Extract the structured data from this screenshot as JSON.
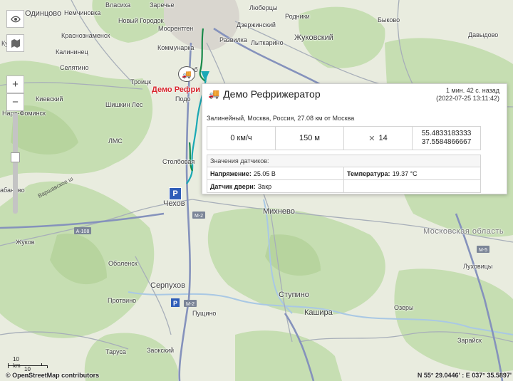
{
  "places": [
    {
      "id": "vlasikha",
      "name": "Власиха"
    },
    {
      "id": "zarechye",
      "name": "Заречье"
    },
    {
      "id": "lyubertsy",
      "name": "Люберцы"
    },
    {
      "id": "odintsovo",
      "name": "Одинцово"
    },
    {
      "id": "nemchinovka",
      "name": "Немчиновка"
    },
    {
      "id": "novy_gorodok",
      "name": "Новый Городок"
    },
    {
      "id": "mosrentgen",
      "name": "Мосрентген"
    },
    {
      "id": "dzerzhinsky",
      "name": "Дзержинский"
    },
    {
      "id": "rodniki",
      "name": "Родники"
    },
    {
      "id": "kubinka",
      "name": "Кубинка"
    },
    {
      "id": "krasnoznamensk",
      "name": "Краснознаменск"
    },
    {
      "id": "razvilka",
      "name": "Развилка"
    },
    {
      "id": "lytkarino",
      "name": "Лыткарино"
    },
    {
      "id": "zhukovsky",
      "name": "Жуковский"
    },
    {
      "id": "bykovo",
      "name": "Быково"
    },
    {
      "id": "davydovo",
      "name": "Давыдово"
    },
    {
      "id": "kalininets",
      "name": "Калининец"
    },
    {
      "id": "kommunarka",
      "name": "Коммунарка"
    },
    {
      "id": "selyatino",
      "name": "Селятино"
    },
    {
      "id": "troitsk",
      "name": "Троицк"
    },
    {
      "id": "shcherbinka",
      "name": "Щерб"
    },
    {
      "id": "kievsky",
      "name": "Киевский"
    },
    {
      "id": "podolsk",
      "name": "Подо"
    },
    {
      "id": "naro_fominsk",
      "name": "Наро-Фоминск"
    },
    {
      "id": "shishkin_les",
      "name": "Шишкин Лес"
    },
    {
      "id": "lms",
      "name": "ЛМС"
    },
    {
      "id": "stolbovaya",
      "name": "Столбовая"
    },
    {
      "id": "chekhov",
      "name": "Чехов"
    },
    {
      "id": "mikhnevo",
      "name": "Михнево"
    },
    {
      "id": "tabanovo",
      "name": "абаново"
    },
    {
      "id": "zhukov",
      "name": "Жуков"
    },
    {
      "id": "moscow_oblast",
      "name": "Московская область"
    },
    {
      "id": "obolensk",
      "name": "Оболенск"
    },
    {
      "id": "lukhovitsy",
      "name": "Луховицы"
    },
    {
      "id": "serpukhov",
      "name": "Серпухов"
    },
    {
      "id": "stupino",
      "name": "Ступино"
    },
    {
      "id": "protvino",
      "name": "Протвино"
    },
    {
      "id": "kashira",
      "name": "Кашира"
    },
    {
      "id": "ozery",
      "name": "Озеры"
    },
    {
      "id": "pushchino",
      "name": "Пущино"
    },
    {
      "id": "zaraysk",
      "name": "Зарайск"
    },
    {
      "id": "tarusa",
      "name": "Таруса"
    },
    {
      "id": "zaoksky",
      "name": "Заокский"
    },
    {
      "id": "ku",
      "name": "Ку"
    }
  ],
  "roads": {
    "a108": "А-108",
    "m2_a": "М-2",
    "m2_b": "М-2",
    "m5": "М-5",
    "varshavskoe": "Варшавское ш"
  },
  "map_tools": {
    "eye_icon": "eye-icon",
    "map_icon": "map-icon",
    "zoom_in": "+",
    "zoom_out": "−"
  },
  "zoom_level_fraction": 0.56,
  "vehicle": {
    "label": "Демо Рефри"
  },
  "parking": {
    "label": "P"
  },
  "popup": {
    "title": "Демо Рефрижератор",
    "time_ago": "1 мин. 42 с. назад",
    "timestamp": "(2022-07-25 13:11:42)",
    "address": "Залинейный, Москва, Россия, 27.08 км от Москва",
    "speed": "0 км/ч",
    "altitude": "150 м",
    "satellites": "14",
    "lat": "55.4833183333",
    "lon": "37.5584866667",
    "sensors_header": "Значения датчиков:",
    "voltage_label": "Напряжение:",
    "voltage_value": "25.05 В",
    "temperature_label": "Температура:",
    "temperature_value": "19.37 °С",
    "door_label": "Датчик двери:",
    "door_value": "Закр"
  },
  "scale": {
    "km": "10 km",
    "mi": "10 mi"
  },
  "attribution": "© OpenStreetMap contributors",
  "coordinates_readout": "N 55° 29.0446' : E 037° 35.5897'",
  "colors": {
    "route_green": "#1a8a4a",
    "route_cyan": "#1aa9b5",
    "forest": "#c8dfb3",
    "road_major": "#8c9bc4",
    "vehicle_label": "#d8262e"
  }
}
